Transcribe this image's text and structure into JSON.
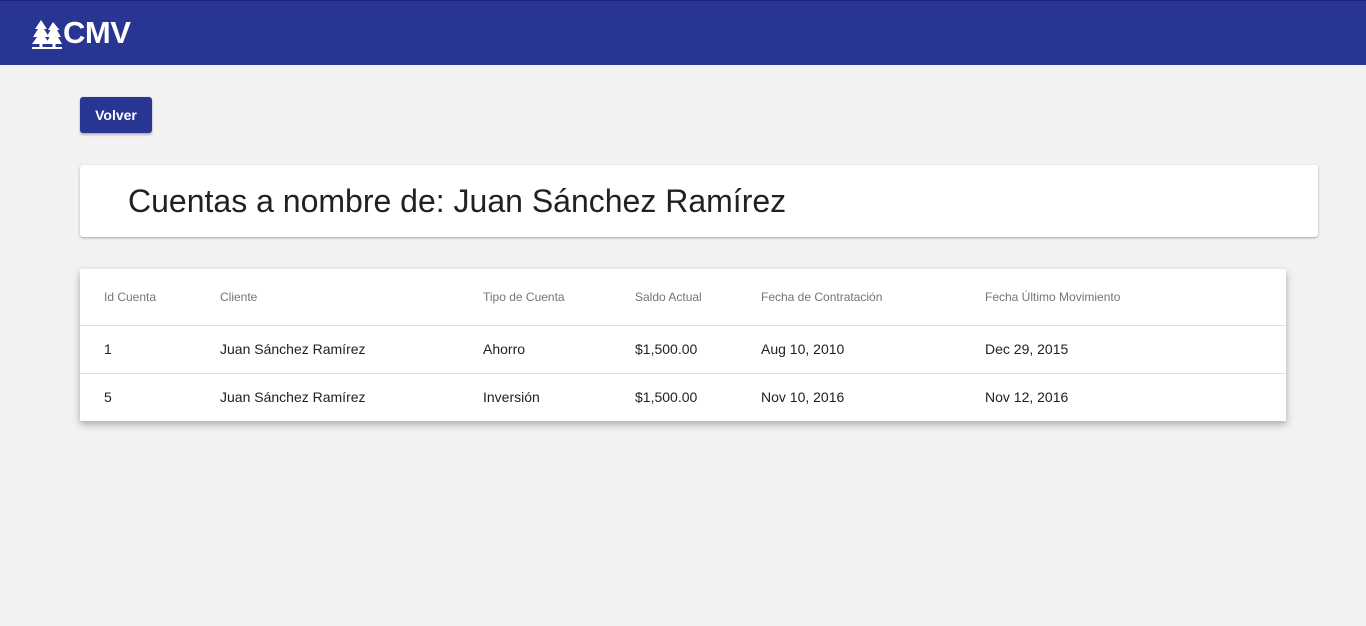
{
  "app": {
    "brand": "CMV"
  },
  "actions": {
    "back_label": "Volver"
  },
  "page": {
    "title": "Cuentas a nombre de: Juan Sánchez Ramírez"
  },
  "table": {
    "headers": [
      "Id Cuenta",
      "Cliente",
      "Tipo de Cuenta",
      "Saldo Actual",
      "Fecha de Contratación",
      "Fecha Último Movimiento"
    ],
    "rows": [
      [
        "1",
        "Juan Sánchez Ramírez",
        "Ahorro",
        "$1,500.00",
        "Aug 10, 2010",
        "Dec 29, 2015"
      ],
      [
        "5",
        "Juan Sánchez Ramírez",
        "Inversión",
        "$1,500.00",
        "Nov 10, 2016",
        "Nov 12, 2016"
      ]
    ]
  },
  "colors": {
    "primary": "#283593",
    "background": "#f2f2f2",
    "card": "#ffffff"
  },
  "icons": {
    "brand": "pine-trees-icon"
  }
}
